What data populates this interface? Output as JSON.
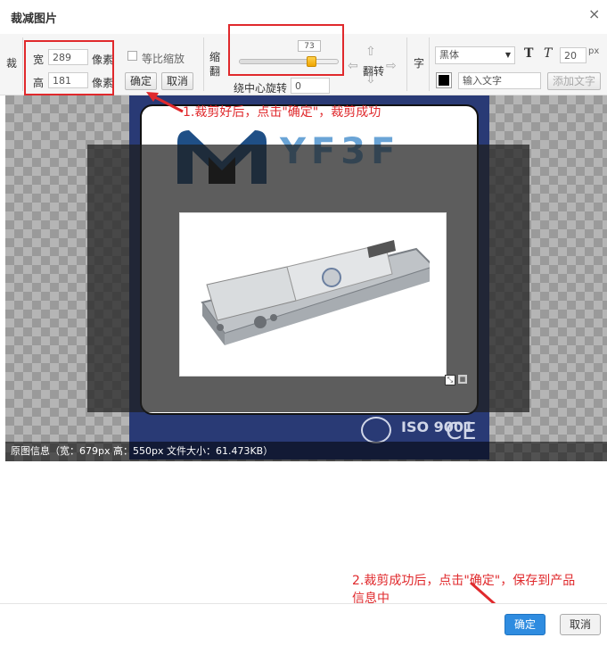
{
  "dialog": {
    "title": "裁减图片",
    "close_icon": "×"
  },
  "crop": {
    "section_label": "裁",
    "width_label": "宽",
    "width_value": "289",
    "width_unit": "像素",
    "height_label": "高",
    "height_value": "181",
    "height_unit": "像素",
    "keep_ratio_label": "等比缩放",
    "confirm_label": "确定",
    "cancel_label": "取消"
  },
  "scale": {
    "section_label": "缩 翻",
    "slider_value": "73",
    "slider_level_percent": 73,
    "rotate_label": "绕中心旋转",
    "rotate_value": "0",
    "flip_label": "翻转"
  },
  "text": {
    "section_label": "字",
    "font_value": "黑体",
    "bold_label": "T",
    "italic_label": "T",
    "size_value": "20",
    "size_unit": "px",
    "color": "#000000",
    "text_placeholder": "输入文字",
    "add_text_label": "添加文字"
  },
  "image": {
    "logo_text": "YF3F",
    "iso_text": "ISO 9001",
    "ce_text": "CE",
    "info": "原图信息（宽：679px 高：550px 文件大小：61.473KB）"
  },
  "annotations": {
    "step1": "1.裁剪好后，点击\"确定\"，裁剪成功",
    "step2_line1": "2.裁剪成功后，点击\"确定\"，保存到产品",
    "step2_line2": "信息中"
  },
  "footer": {
    "ok_label": "确定",
    "cancel_label": "取消"
  },
  "colors": {
    "annotation": "#e0292c",
    "primary_button": "#2f8ce0"
  }
}
